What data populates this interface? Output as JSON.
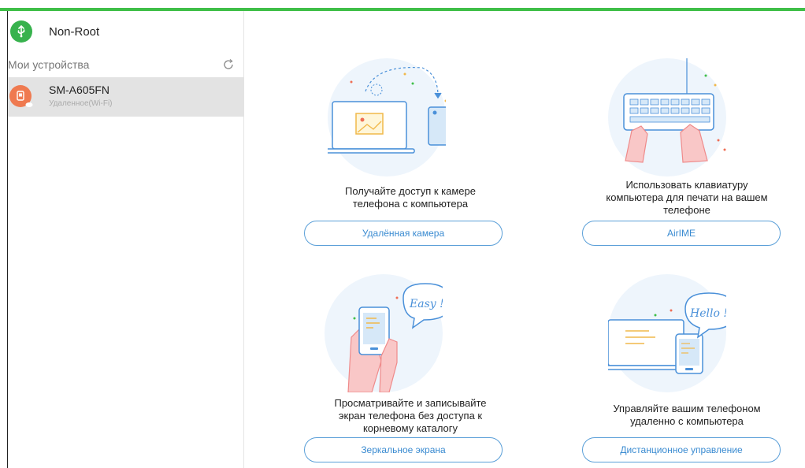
{
  "sidebar": {
    "header_title": "Non-Root",
    "section_title": "Мои устройства",
    "device": {
      "name": "SM-A605FN",
      "status": "Удаленное(Wi-Fi)"
    }
  },
  "features": [
    {
      "desc_lines": [
        "Получайте доступ к камере",
        "телефона с компьютера"
      ],
      "button": "Удалённая камера"
    },
    {
      "desc_lines": [
        "Использовать клавиатуру",
        "компьютера для печати на вашем",
        "телефоне"
      ],
      "button": "AirIME"
    },
    {
      "desc_lines": [
        "Просматривайте и записывайте",
        "экран телефона без доступа к",
        "корневому каталогу"
      ],
      "button": "Зеркальное экрана"
    },
    {
      "desc_lines": [
        "Управляйте вашим телефоном",
        "удаленно с компьютера"
      ],
      "button": "Дистанционное управление"
    }
  ],
  "illustration_text": {
    "easy": "Easy !",
    "hello": "Hello !"
  },
  "colors": {
    "accent_green": "#3fbf48",
    "button_blue": "#3a8bd1",
    "device_orange": "#ef7a50"
  }
}
